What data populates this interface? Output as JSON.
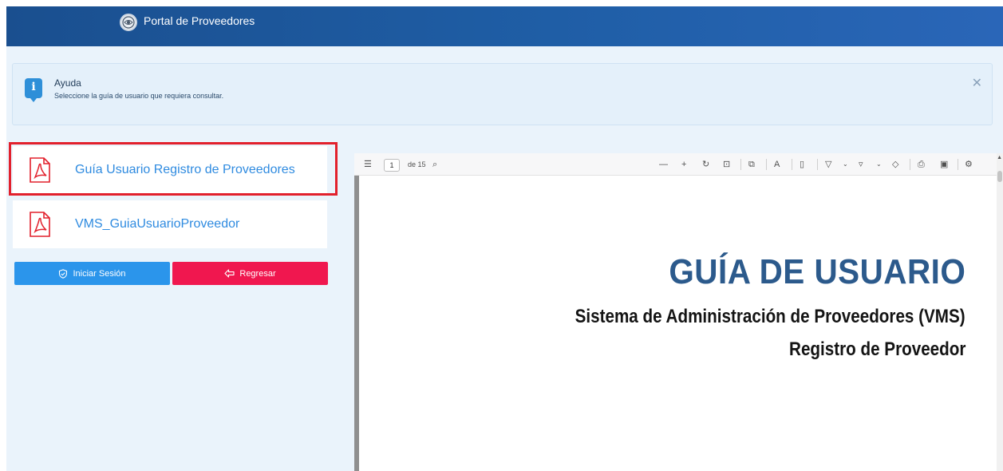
{
  "header": {
    "title": "Portal de Proveedores"
  },
  "alert": {
    "icon": "info-icon",
    "icon_glyph": "i",
    "title": "Ayuda",
    "text": "Seleccione la guía de usuario que requiera consultar.",
    "close_glyph": "✕"
  },
  "documents": [
    {
      "name": "Guía Usuario Registro de Proveedores",
      "icon": "pdf-icon",
      "selected": true
    },
    {
      "name": "VMS_GuiaUsuarioProveedor",
      "icon": "pdf-icon",
      "selected": false
    }
  ],
  "buttons": {
    "login_label": "Iniciar Sesión",
    "back_label": "Regresar"
  },
  "viewer": {
    "page_current": "1",
    "page_of": "de 15",
    "document_title": "GUÍA DE USUARIO",
    "document_subtitle_1": "Sistema de Administración de Proveedores (VMS)",
    "document_subtitle_2": "Registro de Proveedor"
  },
  "colors": {
    "header": "#1f5ea6",
    "alert_bg": "#e4f0fa",
    "selected_border": "#e2202c",
    "link_blue": "#2f8be0",
    "login_button": "#2b95eb",
    "back_button": "#f0174f",
    "doc_title": "#2c5a8c"
  }
}
